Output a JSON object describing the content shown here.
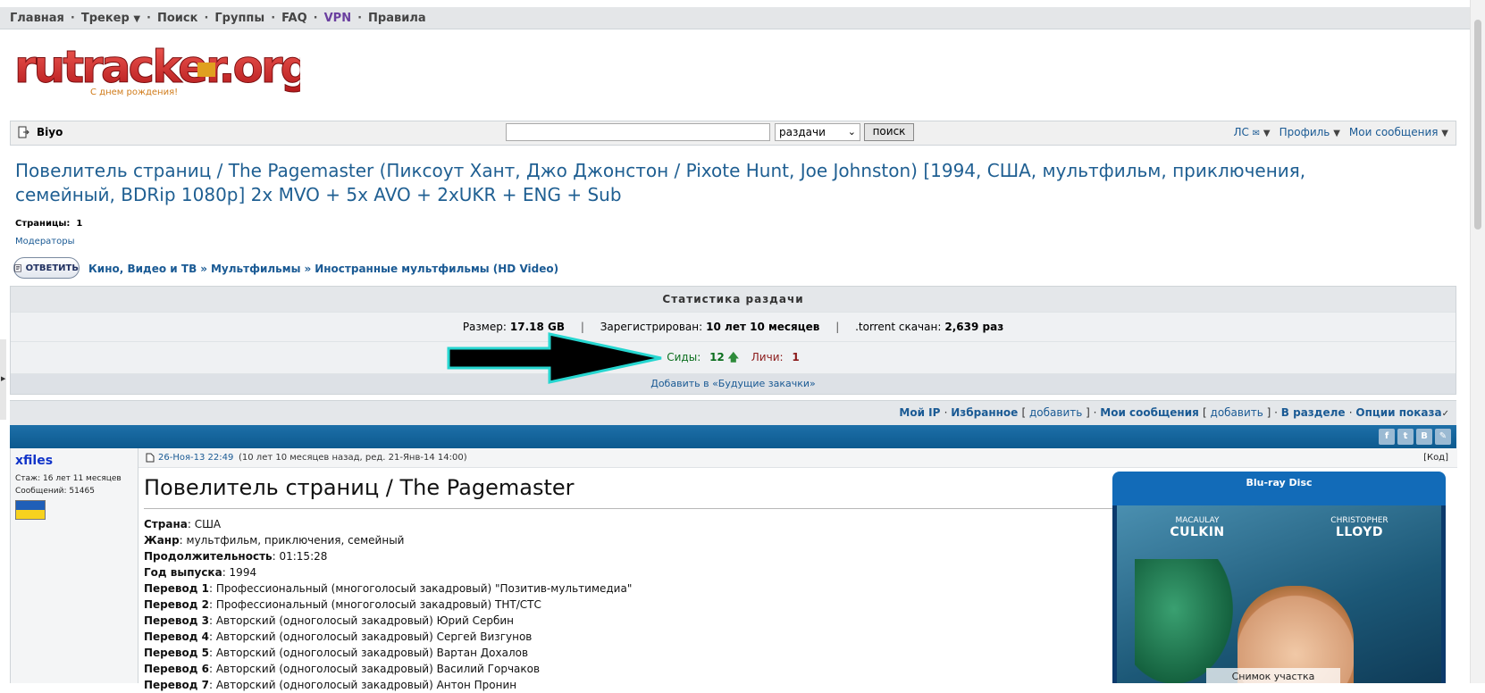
{
  "nav": {
    "items": [
      "Главная",
      "Трекер",
      "Поиск",
      "Группы",
      "FAQ",
      "VPN",
      "Правила"
    ]
  },
  "logo": {
    "text": "rutracker.org",
    "tagline": "С днем рождения!"
  },
  "search": {
    "username": "Biyo",
    "placeholder": "",
    "scope": "раздачи",
    "button": "поиск",
    "menu": [
      "ЛС",
      "Профиль",
      "Мои сообщения"
    ]
  },
  "topic": {
    "title": "Повелитель страниц / The Pagemaster (Пиксоут Хант, Джо Джонстон / Pixote Hunt, Joe Johnston) [1994, США, мультфильм, приключения, семейный, BDRip 1080p] 2x MVO + 5x AVO + 2xUKR + ENG + Sub",
    "pages_label": "Страницы:",
    "pages_value": "1",
    "moderators": "Модераторы",
    "reply_button": "ОТВЕТИТЬ",
    "breadcrumbs": [
      "Кино, Видео и ТВ",
      "Мультфильмы",
      "Иностранные мультфильмы (HD Video)"
    ],
    "breadcrumb_sep": "»"
  },
  "stats": {
    "header": "Статистика раздачи",
    "size_label": "Размер:",
    "size_value": "17.18 GB",
    "registered_label": "Зарегистрирован:",
    "registered_value": "10 лет 10 месяцев",
    "downloaded_label": ".torrent скачан:",
    "downloaded_value": "2,639 раз",
    "seeds_label": "Сиды:",
    "seeds_value": "12",
    "leech_label": "Личи:",
    "leech_value": "1",
    "future": "Добавить в «Будущие закачки»"
  },
  "options": {
    "my_ip": "Мой IP",
    "fav": "Избранное",
    "add1": "добавить",
    "my_msgs": "Мои сообщения",
    "add2": "добавить",
    "in_section": "В разделе",
    "opts": "Опции показа"
  },
  "social": [
    "f",
    "t",
    "В",
    "✎"
  ],
  "post": {
    "author": "xfiles",
    "stage": "Стаж: 16 лет 11 месяцев",
    "messages": "Сообщений: 51465",
    "date": "26-Ноя-13 22:49",
    "ago": "(10 лет 10 месяцев назад, ред. 21-Янв-14 14:00)",
    "code": "[Код]",
    "title": "Повелитель страниц / The Pagemaster",
    "fields": [
      {
        "k": "Страна",
        "v": ": США"
      },
      {
        "k": "Жанр",
        "v": ": мультфильм, приключения, семейный"
      },
      {
        "k": "Продолжительность",
        "v": ": 01:15:28"
      },
      {
        "k": "Год выпуска",
        "v": ": 1994"
      },
      {
        "k": "Перевод 1",
        "v": ": Профессиональный (многоголосый закадровый) \"Позитив-мультимедиа\""
      },
      {
        "k": "Перевод 2",
        "v": ": Профессиональный (многоголосый закадровый) ТНТ/СТС"
      },
      {
        "k": "Перевод 3",
        "v": ": Авторский (одноголосый закадровый) Юрий Сербин"
      },
      {
        "k": "Перевод 4",
        "v": ": Авторский (одноголосый закадровый) Сергей Визгунов"
      },
      {
        "k": "Перевод 5",
        "v": ": Авторский (одноголосый закадровый) Вартан Дохалов"
      },
      {
        "k": "Перевод 6",
        "v": ": Авторский (одноголосый закадровый) Василий Горчаков"
      },
      {
        "k": "Перевод 7",
        "v": ": Авторский (одноголосый закадровый) Антон Пронин"
      }
    ]
  },
  "poster": {
    "brand": "Blu-ray Disc",
    "actor1_first": "MACAULAY",
    "actor1_last": "CULKIN",
    "actor2_first": "CHRISTOPHER",
    "actor2_last": "LLOYD",
    "snapshot": "Снимок участка"
  }
}
